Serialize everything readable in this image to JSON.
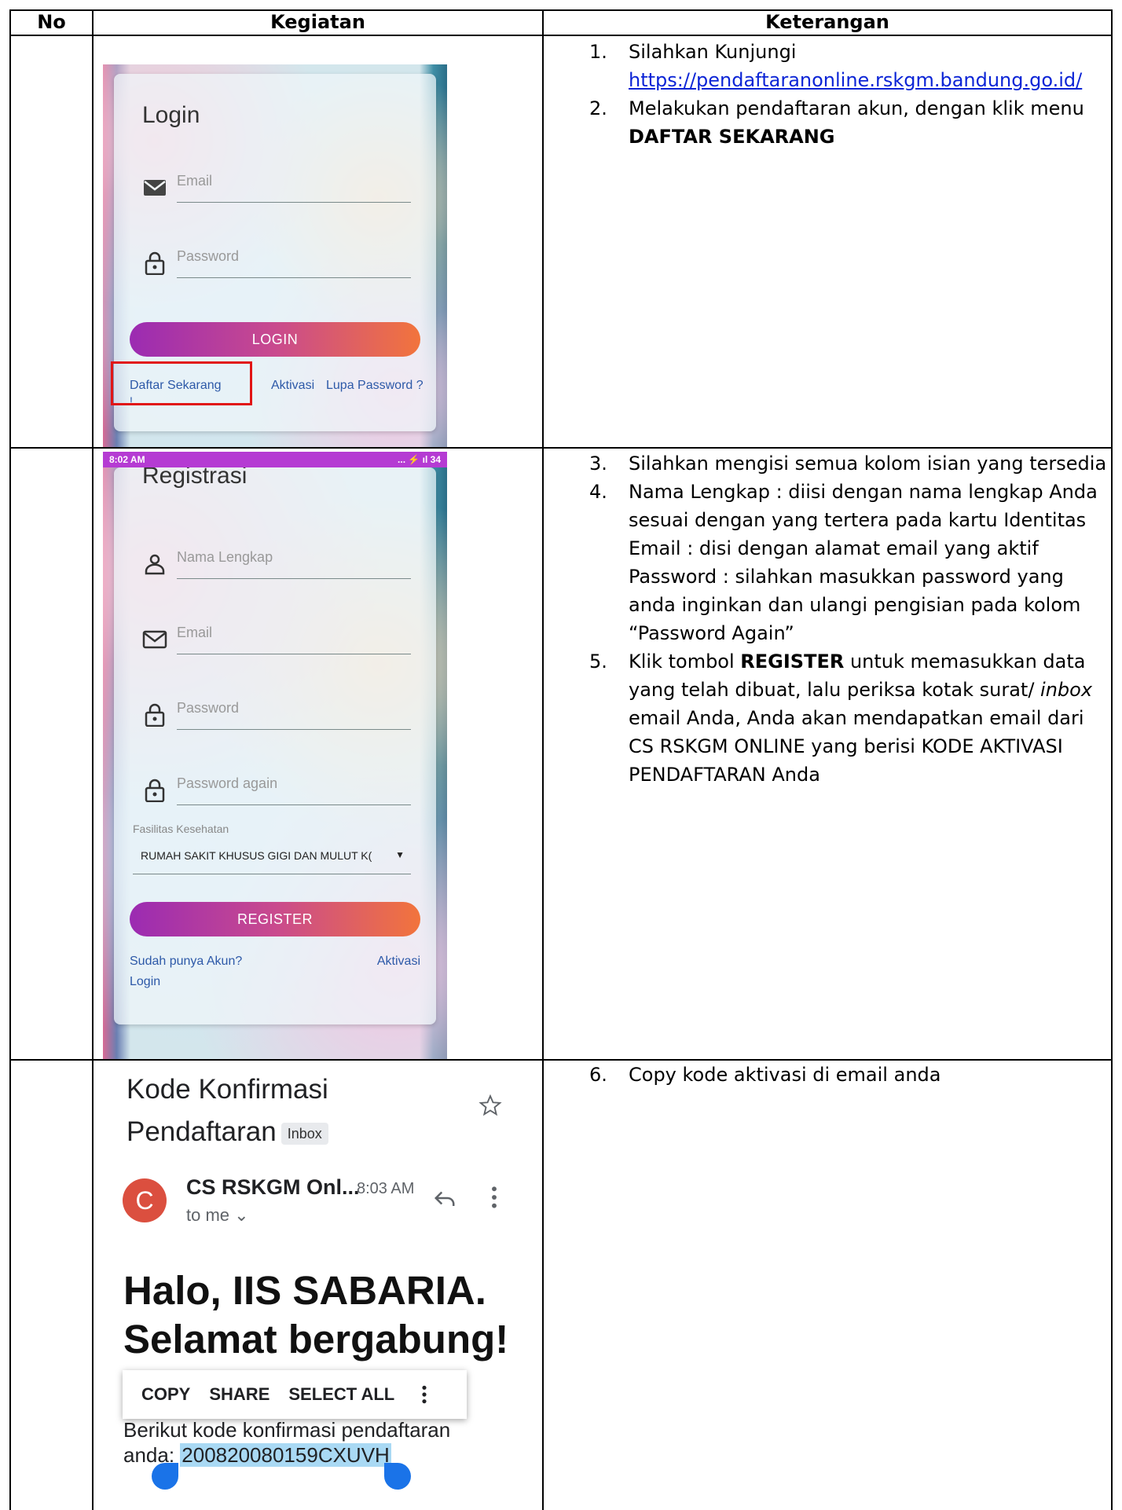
{
  "table": {
    "headers": [
      "No",
      "Kegiatan",
      "Keterangan"
    ],
    "rows": [
      {
        "no": "",
        "steps": [
          {
            "num": "1.",
            "text": "Silahkan Kunjungi",
            "link": "https://pendaftaranonline.rskgm.bandung.go.id/"
          },
          {
            "num": "2.",
            "text": "Melakukan pendaftaran akun, dengan klik menu",
            "bold": "DAFTAR SEKARANG"
          }
        ]
      },
      {
        "no": "",
        "steps": [
          {
            "num": "3.",
            "text": "Silahkan mengisi semua kolom isian yang tersedia"
          },
          {
            "num": "4.",
            "text": "Nama Lengkap : diisi dengan nama lengkap Anda sesuai dengan yang tertera pada kartu Identitas Email : disi dengan alamat email yang aktif Password : silahkan masukkan password yang anda inginkan dan ulangi pengisian pada kolom “Password Again”"
          },
          {
            "num": "5.",
            "text_a": "Klik tombol ",
            "bold": "REGISTER",
            "text_b": " untuk memasukkan data yang telah dibuat, lalu periksa kotak surat/ ",
            "italic": "inbox",
            "text_c": " email Anda, Anda akan mendapatkan email dari CS RSKGM ONLINE yang berisi KODE AKTIVASI PENDAFTARAN Anda"
          }
        ]
      },
      {
        "no": "",
        "steps": [
          {
            "num": "6.",
            "text": "Copy kode aktivasi di email anda"
          }
        ]
      }
    ]
  },
  "login_screen": {
    "title": "Login",
    "email_label": "Email",
    "password_label": "Password",
    "button": "LOGIN",
    "register_link": "Daftar Sekarang",
    "activate_link": "Aktivasi",
    "forgot_link": "Lupa Password ?",
    "stray": "!"
  },
  "register_screen": {
    "status_time": "8:02 AM",
    "status_icons": "... ⚡ ıl 34",
    "title": "Registrasi",
    "fullname_label": "Nama Lengkap",
    "email_label": "Email",
    "password_label": "Password",
    "password_again_label": "Password again",
    "facility_label": "Fasilitas Kesehatan",
    "facility_value": "RUMAH SAKIT KHUSUS GIGI DAN MULUT K(",
    "button": "REGISTER",
    "have_account": "Sudah punya Akun?",
    "login_link": "Login",
    "activate_link": "Aktivasi"
  },
  "email_screen": {
    "subject_line1": "Kode Konfirmasi",
    "subject_line2": "Pendaftaran",
    "inbox_tag": "Inbox",
    "avatar_letter": "C",
    "sender": "CS RSKGM Onl...",
    "time": "8:03 AM",
    "to": "to me ⌄",
    "greeting_line1": "Halo, IIS SABARIA.",
    "greeting_line2": "Selamat bergabung!",
    "menu": [
      "COPY",
      "SHARE",
      "SELECT ALL"
    ],
    "body_line1": "Berikut kode konfirmasi pendaftaran",
    "body_prefix": "anda: ",
    "code": "200820080159CXUVH"
  }
}
